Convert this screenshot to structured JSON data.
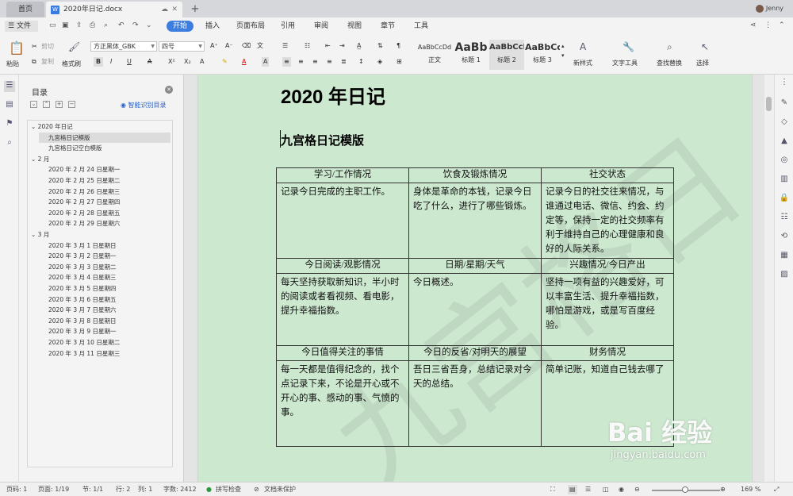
{
  "tabs": {
    "home": "首页",
    "doc": "2020年日记.docx",
    "add": "+"
  },
  "user": {
    "name": "Jenny"
  },
  "menu": {
    "file": "文件",
    "items": [
      "开始",
      "插入",
      "页面布局",
      "引用",
      "审阅",
      "视图",
      "章节",
      "工具"
    ]
  },
  "ribbon": {
    "paste": "粘贴",
    "cut": "剪切",
    "copy": "复制",
    "format_painter": "格式刷",
    "font_name": "方正黑体_GBK",
    "font_size": "四号",
    "styles": [
      {
        "preview": "AaBbCcDd",
        "name": "正文"
      },
      {
        "preview": "AaBb",
        "name": "标题 1"
      },
      {
        "preview": "AaBbCcI",
        "name": "标题 2"
      },
      {
        "preview": "AaBbCc",
        "name": "标题 3"
      }
    ],
    "new_style": "新样式",
    "text_tools": "文字工具",
    "find_replace": "查找替换",
    "select": "选择"
  },
  "toc": {
    "title": "目录",
    "smart": "智能识别目录",
    "items": [
      {
        "label": "2020 年日记",
        "level": 0,
        "arrow": "⌄"
      },
      {
        "label": "九宫格日记模版",
        "level": 1,
        "selected": true
      },
      {
        "label": "九宫格日记空白模版",
        "level": 1
      },
      {
        "label": "2 月",
        "level": 0,
        "arrow": "⌄"
      },
      {
        "label": "2020 年 2 月 24 日星期一",
        "level": 1
      },
      {
        "label": "2020 年 2 月 25 日星期二",
        "level": 1
      },
      {
        "label": "2020 年 2 月 26 日星期三",
        "level": 1
      },
      {
        "label": "2020 年 2 月 27 日星期四",
        "level": 1
      },
      {
        "label": "2020 年 2 月 28 日星期五",
        "level": 1
      },
      {
        "label": "2020 年 2 月 29 日星期六",
        "level": 1
      },
      {
        "label": "3 月",
        "level": 0,
        "arrow": "⌄"
      },
      {
        "label": "2020 年 3 月 1 日星期日",
        "level": 1
      },
      {
        "label": "2020 年 3 月 2 日星期一",
        "level": 1
      },
      {
        "label": "2020 年 3 月 3 日星期二",
        "level": 1
      },
      {
        "label": "2020 年 3 月 4 日星期三",
        "level": 1
      },
      {
        "label": "2020 年 3 月 5 日星期四",
        "level": 1
      },
      {
        "label": "2020 年 3 月 6 日星期五",
        "level": 1
      },
      {
        "label": "2020 年 3 月 7 日星期六",
        "level": 1
      },
      {
        "label": "2020 年 3 月 8 日星期日",
        "level": 1
      },
      {
        "label": "2020 年 3 月 9 日星期一",
        "level": 1
      },
      {
        "label": "2020 年 3 月 10 日星期二",
        "level": 1
      },
      {
        "label": "2020 年 3 月 11 日星期三",
        "level": 1
      }
    ]
  },
  "document": {
    "title": "2020 年日记",
    "subtitle": "九宫格日记模版",
    "grid": [
      {
        "headers": [
          "学习/工作情况",
          "饮食及锻炼情况",
          "社交状态"
        ],
        "cells": [
          "记录今日完成的主职工作。",
          "身体是革命的本钱，记录今日吃了什么，进行了哪些锻炼。",
          "记录今日的社交往来情况，与谁通过电话、微信、约会、约定等，保持一定的社交频率有利于维持自己的心理健康和良好的人际关系。"
        ]
      },
      {
        "headers": [
          "今日阅读/观影情况",
          "日期/星期/天气",
          "兴趣情况/今日产出"
        ],
        "cells": [
          "每天坚持获取新知识，半小时的阅读或者看视频、看电影，提升幸福指数。",
          "今日概述。",
          "坚持一项有益的兴趣爱好，可以丰富生活、提升幸福指数，哪怕是游戏，或是写百度经验。"
        ]
      },
      {
        "headers": [
          "今日值得关注的事情",
          "今日的反省/对明天的展望",
          "财务情况"
        ],
        "cells": [
          "每一天都是值得纪念的，找个点记录下来，不论是开心或不开心的事、感动的事、气愤的事。",
          "吾日三省吾身，总结记录对今天的总结。",
          "简单记账，知道自己钱去哪了"
        ]
      }
    ],
    "watermark": "九宫格日"
  },
  "status": {
    "page_code": "页码: 1",
    "page": "页面: 1/19",
    "section": "节: 1/1",
    "row": "行: 2",
    "col": "列: 1",
    "words": "字数: 2412",
    "spell": "拼写检查",
    "protect": "文档未保护",
    "zoom": "169 %"
  },
  "overlay": {
    "logo": "Bai 经验",
    "url": "jingyan.baidu.com"
  },
  "colors": {
    "accent": "#3b7ee0",
    "page_bg": "#cce8cf"
  }
}
